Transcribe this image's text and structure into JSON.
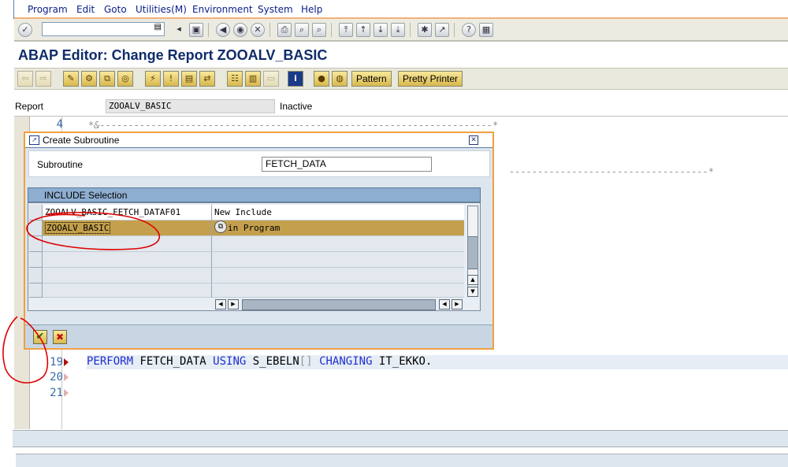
{
  "menu": {
    "items": [
      "Program",
      "Edit",
      "Goto",
      "Utilities(M)",
      "Environment",
      "System",
      "Help"
    ]
  },
  "title": "ABAP Editor: Change Report ZOOALV_BASIC",
  "app_toolbar": {
    "pattern_label": "Pattern",
    "pretty_printer_label": "Pretty Printer"
  },
  "report": {
    "label": "Report",
    "name": "ZOOALV_BASIC",
    "status": "Inactive"
  },
  "editor": {
    "lines": [
      {
        "num": "4",
        "text": "*&---------------------------------------------------------------------*"
      },
      {
        "num": "19"
      },
      {
        "num": "20",
        "text": ""
      },
      {
        "num": "21",
        "text": ""
      }
    ],
    "line19": {
      "kw1": "PERFORM",
      "t1": " FETCH_DATA ",
      "kw2": "USING",
      "t2": " S_EBELN",
      "br": "[]",
      "sp": " ",
      "kw3": "CHANGING",
      "t3": " IT_EKKO."
    },
    "partial_comment": "-----------------------------------*"
  },
  "dialog": {
    "title": "Create Subroutine",
    "subroutine_label": "Subroutine",
    "subroutine_value": "FETCH_DATA",
    "include_header": "INCLUDE Selection",
    "rows": [
      {
        "include": "ZOOALV_BASIC_FETCH_DATAF01",
        "desc": "New Include"
      },
      {
        "include": "ZOOALV_BASIC",
        "desc": "in Program"
      }
    ]
  },
  "colors": {
    "accent_orange": "#f0a040",
    "title_blue": "#0f2c6a",
    "keyword_blue": "#1e2fd0",
    "selected_row": "#c4a04c",
    "annotation_red": "#dd0000"
  }
}
